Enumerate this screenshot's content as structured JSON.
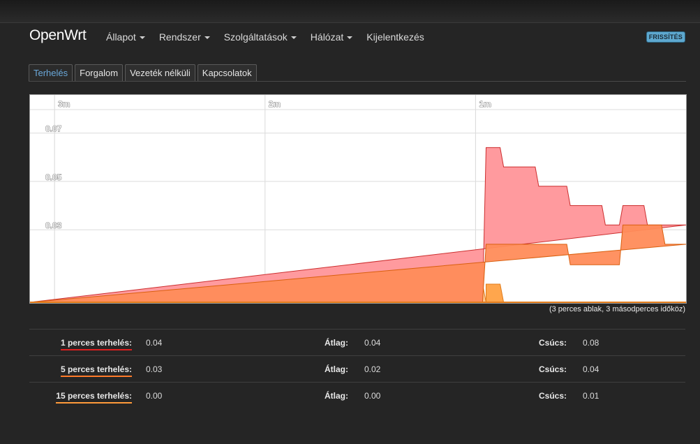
{
  "app": {
    "brand": "OpenWrt",
    "menu": [
      {
        "label": "Állapot",
        "dropdown": true
      },
      {
        "label": "Rendszer",
        "dropdown": true
      },
      {
        "label": "Szolgáltatások",
        "dropdown": true
      },
      {
        "label": "Hálózat",
        "dropdown": true
      },
      {
        "label": "Kijelentkezés",
        "dropdown": false
      }
    ],
    "refresh_badge": "FRISSÍTÉS"
  },
  "tabs": [
    {
      "label": "Terhelés",
      "active": true
    },
    {
      "label": "Forgalom",
      "active": false
    },
    {
      "label": "Vezeték nélküli",
      "active": false
    },
    {
      "label": "Kapcsolatok",
      "active": false
    }
  ],
  "chart_note": "(3 perces ablak, 3 másodperces időköz)",
  "chart_data": {
    "type": "area",
    "x_ticks": [
      {
        "label": "3m",
        "t": -180
      },
      {
        "label": "2m",
        "t": -120
      },
      {
        "label": "1m",
        "t": -60
      }
    ],
    "y_ticks": [
      {
        "label": "0.07",
        "v": 0.07
      },
      {
        "label": "0.05",
        "v": 0.05
      },
      {
        "label": "0.03",
        "v": 0.03
      }
    ],
    "xlim": [
      -187,
      0
    ],
    "ylim": [
      0,
      0.08
    ],
    "grid": true,
    "colors": {
      "load1_fill": "#ff9a9e",
      "load1_line": "#cc2e2e",
      "load5_fill": "#ff8c5a",
      "load5_line": "#d95f0e",
      "load15_fill": "#ffc58e",
      "load15_line": "#e07b1a",
      "overlap": "#ffa64d"
    },
    "series": [
      {
        "key": "load15",
        "points": [
          [
            -187,
            0
          ],
          [
            -78,
            0
          ],
          [
            -77,
            0.0075
          ],
          [
            -58,
            0.0075
          ],
          [
            -57,
            0
          ],
          [
            0,
            0
          ]
        ]
      },
      {
        "key": "load5",
        "points": [
          [
            -187,
            0
          ],
          [
            -58,
            0
          ],
          [
            -57,
            0.024
          ],
          [
            -34,
            0.024
          ],
          [
            -33,
            0.0155
          ],
          [
            -19,
            0.0155
          ],
          [
            -18,
            0.032
          ],
          [
            -7,
            0.032
          ],
          [
            -6,
            0.024
          ],
          [
            0,
            0.024
          ]
        ]
      },
      {
        "key": "load1",
        "points": [
          [
            -187,
            0
          ],
          [
            -58,
            0
          ],
          [
            -57,
            0.064
          ],
          [
            -53,
            0.064
          ],
          [
            -52,
            0.056
          ],
          [
            -43,
            0.056
          ],
          [
            -42,
            0.048
          ],
          [
            -34,
            0.048
          ],
          [
            -33,
            0.04
          ],
          [
            -24,
            0.04
          ],
          [
            -23,
            0.032
          ],
          [
            -19,
            0.032
          ],
          [
            -18,
            0.04
          ],
          [
            -12,
            0.04
          ],
          [
            -11,
            0.032
          ],
          [
            0,
            0.032
          ]
        ]
      },
      {
        "key": "peak",
        "points": [
          [
            -57,
            0
          ],
          [
            -57,
            0.0075
          ],
          [
            -53,
            0.0075
          ],
          [
            -52,
            0
          ],
          [
            -57,
            0
          ]
        ]
      }
    ]
  },
  "stats": [
    {
      "label": "1 perces terhelés:",
      "value": "0.04",
      "avg_label": "Átlag:",
      "avg": "0.04",
      "peak_label": "Csúcs:",
      "peak": "0.08",
      "underline": "#dd1f1f"
    },
    {
      "label": "5 perces terhelés:",
      "value": "0.03",
      "avg_label": "Átlag:",
      "avg": "0.02",
      "peak_label": "Csúcs:",
      "peak": "0.04",
      "underline": "#ff7a2a"
    },
    {
      "label": "15 perces terhelés:",
      "value": "0.00",
      "avg_label": "Átlag:",
      "avg": "0.00",
      "peak_label": "Csúcs:",
      "peak": "0.01",
      "underline": "#ff9a3a"
    }
  ]
}
